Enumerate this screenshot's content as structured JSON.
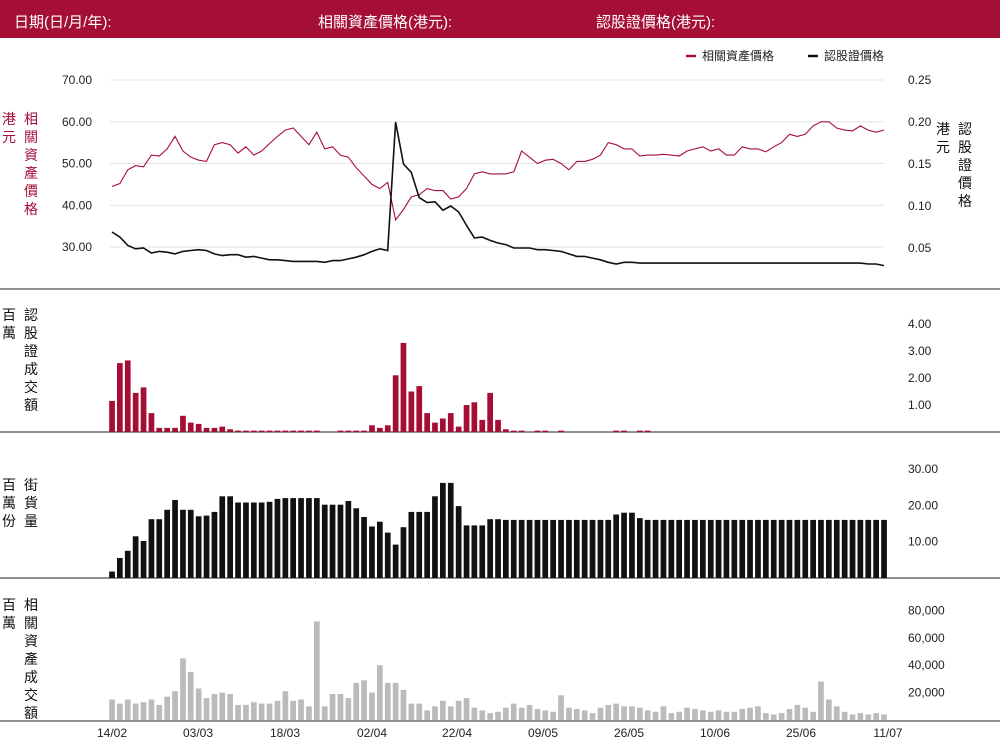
{
  "header": {
    "date_label": "日期(日/月/年):",
    "underlying_label": "相關資產價格(港元):",
    "warrant_label": "認股證價格(港元):"
  },
  "colors": {
    "header_bg": "#a50e35",
    "underlying": "#a50e35",
    "warrant": "#111111",
    "underlying_turnover": "#bbbbbb"
  },
  "chart_data": [
    {
      "type": "line",
      "legend": [
        "相關資產價格",
        "認股證價格"
      ],
      "legend_position": "top-right",
      "ylabel_left": "相關資產價格(港元)",
      "ylabel_right": "認股證價格(港元)",
      "ylim_left": [
        20,
        75
      ],
      "ylim_right": [
        0.01,
        0.26
      ],
      "yticks_left": [
        "30.00",
        "40.00",
        "50.00",
        "60.00",
        "70.00"
      ],
      "yticks_right": [
        "0.05",
        "0.10",
        "0.15",
        "0.20",
        "0.25"
      ],
      "series": [
        {
          "name": "相關資產價格",
          "axis": "left",
          "values": [
            44.5,
            45.2,
            48.5,
            49.5,
            49.2,
            52,
            51.8,
            53.5,
            56.5,
            53,
            51.5,
            50.8,
            50.5,
            54.5,
            55,
            54.5,
            52.5,
            54,
            52,
            53,
            54.8,
            56.5,
            58,
            58.5,
            56.5,
            54.5,
            57.5,
            53.5,
            54,
            52,
            51.5,
            49,
            47,
            45,
            44,
            45.5,
            36.5,
            39,
            42,
            42.5,
            44,
            43.5,
            43.5,
            41.5,
            42,
            44,
            47.5,
            48,
            47.5,
            47.5,
            47.5,
            48,
            53,
            51.5,
            50,
            50.8,
            51,
            50,
            48.5,
            50.5,
            50.5,
            51,
            52,
            55,
            54.5,
            53.5,
            53.5,
            51.8,
            52,
            52,
            52.2,
            52,
            51.8,
            53,
            53.5,
            54,
            53,
            53.5,
            52,
            52,
            54,
            53.5,
            53.5,
            52.8,
            54,
            55,
            57,
            56.5,
            57,
            59,
            60,
            60,
            58.5,
            58,
            57.8,
            59,
            58,
            57.5,
            58
          ]
        },
        {
          "name": "認股證價格",
          "axis": "right",
          "values": [
            0.069,
            0.063,
            0.053,
            0.049,
            0.05,
            0.044,
            0.046,
            0.045,
            0.043,
            0.046,
            0.047,
            0.048,
            0.047,
            0.043,
            0.041,
            0.042,
            0.042,
            0.039,
            0.04,
            0.038,
            0.036,
            0.036,
            0.035,
            0.034,
            0.034,
            0.034,
            0.034,
            0.033,
            0.035,
            0.035,
            0.037,
            0.039,
            0.042,
            0.046,
            0.049,
            0.047,
            0.2,
            0.15,
            0.14,
            0.11,
            0.104,
            0.105,
            0.095,
            0.1,
            0.093,
            0.077,
            0.062,
            0.063,
            0.059,
            0.056,
            0.054,
            0.05,
            0.05,
            0.05,
            0.048,
            0.048,
            0.047,
            0.046,
            0.043,
            0.04,
            0.04,
            0.038,
            0.036,
            0.033,
            0.031,
            0.033,
            0.033,
            0.032,
            0.032,
            0.032,
            0.032,
            0.032,
            0.032,
            0.032,
            0.032,
            0.032,
            0.032,
            0.032,
            0.032,
            0.032,
            0.032,
            0.032,
            0.032,
            0.032,
            0.032,
            0.032,
            0.032,
            0.032,
            0.032,
            0.032,
            0.032,
            0.032,
            0.032,
            0.032,
            0.032,
            0.032,
            0.031,
            0.031,
            0.029
          ]
        }
      ]
    },
    {
      "type": "bar",
      "ylabel": "認股證成交額(百萬)",
      "ylim": [
        0,
        4.5
      ],
      "yticks": [
        "1.00",
        "2.00",
        "3.00",
        "4.00"
      ],
      "values": [
        1.15,
        2.55,
        2.65,
        1.45,
        1.65,
        0.7,
        0.15,
        0.15,
        0.15,
        0.6,
        0.35,
        0.3,
        0.15,
        0.15,
        0.2,
        0.1,
        0.05,
        0.05,
        0.05,
        0.05,
        0.05,
        0.05,
        0.05,
        0.05,
        0.05,
        0.05,
        0.05,
        0,
        0,
        0.05,
        0.05,
        0.05,
        0.05,
        0.25,
        0.15,
        0.25,
        2.1,
        3.3,
        1.5,
        1.7,
        0.7,
        0.35,
        0.5,
        0.7,
        0.2,
        1.0,
        1.1,
        0.45,
        1.45,
        0.45,
        0.1,
        0.05,
        0.05,
        0,
        0.05,
        0.05,
        0,
        0.05,
        0,
        0,
        0,
        0,
        0,
        0,
        0.05,
        0.05,
        0,
        0.05,
        0.05,
        0,
        0,
        0,
        0,
        0,
        0,
        0,
        0,
        0,
        0,
        0,
        0,
        0,
        0,
        0,
        0,
        0,
        0,
        0,
        0,
        0,
        0,
        0,
        0,
        0,
        0,
        0,
        0,
        0,
        0
      ]
    },
    {
      "type": "bar",
      "ylabel": "街貨量(百萬份)",
      "ylim": [
        0,
        30
      ],
      "yticks": [
        "10.00",
        "20.00",
        "30.00"
      ],
      "values": [
        1.8,
        5.5,
        7.5,
        11.5,
        10.2,
        16.2,
        16.2,
        18.8,
        21.5,
        18.8,
        18.8,
        17,
        17.2,
        18.2,
        22.5,
        22.5,
        20.8,
        20.8,
        20.8,
        20.8,
        21,
        21.8,
        22,
        22,
        22,
        22,
        22,
        20.2,
        20.2,
        20.2,
        21.2,
        19.2,
        16.8,
        14.2,
        15.5,
        12.5,
        9.2,
        14,
        18.2,
        18.2,
        18.2,
        22.5,
        26.2,
        26.2,
        19.8,
        14.5,
        14.5,
        14.5,
        16.2,
        16.2,
        16,
        16,
        16,
        16,
        16,
        16,
        16,
        16,
        16,
        16,
        16,
        16,
        16,
        16,
        17.5,
        18,
        18,
        16.5,
        16,
        16,
        16,
        16,
        16,
        16,
        16,
        16,
        16,
        16,
        16,
        16,
        16,
        16,
        16,
        16,
        16,
        16,
        16,
        16,
        16,
        16,
        16,
        16,
        16,
        16,
        16,
        16,
        16,
        16,
        16
      ]
    },
    {
      "type": "bar",
      "ylabel": "相關資產成交額(百萬)",
      "ylim": [
        0,
        90000
      ],
      "yticks": [
        "20,000",
        "40,000",
        "60,000",
        "80,000"
      ],
      "categories": [
        "14/02",
        "03/03",
        "18/03",
        "02/04",
        "22/04",
        "09/05",
        "26/05",
        "10/06",
        "25/06",
        "11/07"
      ],
      "values": [
        15000,
        12000,
        15000,
        12000,
        13000,
        15000,
        11000,
        17000,
        21000,
        45000,
        35000,
        23000,
        16000,
        19000,
        20000,
        19000,
        11000,
        11000,
        13000,
        12000,
        12000,
        14000,
        21000,
        14000,
        15000,
        10000,
        72000,
        10000,
        19000,
        19000,
        16000,
        27000,
        29000,
        20000,
        40000,
        27000,
        27000,
        22000,
        12000,
        12000,
        7000,
        10000,
        14000,
        10000,
        14000,
        16000,
        9000,
        7000,
        5000,
        6000,
        9000,
        12000,
        9000,
        11000,
        8000,
        7000,
        6000,
        18000,
        9000,
        8000,
        7000,
        5000,
        9000,
        11000,
        12000,
        10000,
        10000,
        9000,
        7000,
        6000,
        10000,
        5000,
        6000,
        9000,
        8000,
        7000,
        6000,
        7000,
        6000,
        6000,
        8000,
        9000,
        10000,
        5000,
        4000,
        5000,
        8000,
        11000,
        9000,
        6000,
        28000,
        15000,
        10000,
        6000,
        4000,
        5000,
        4000,
        5000,
        4000
      ]
    }
  ]
}
